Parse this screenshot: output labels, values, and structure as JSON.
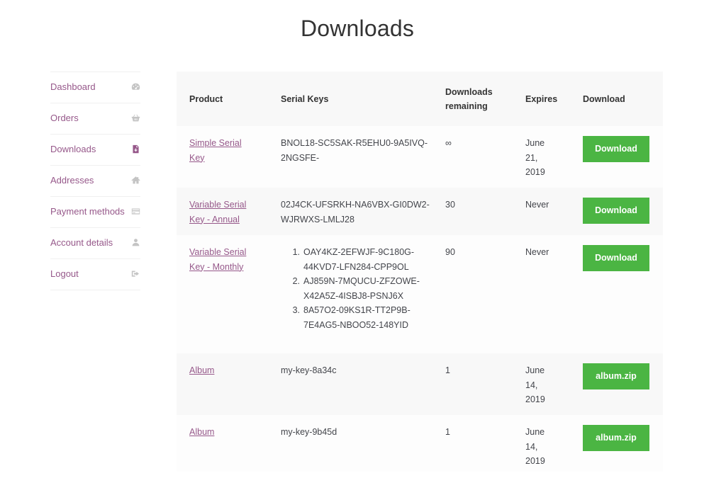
{
  "page": {
    "title": "Downloads"
  },
  "nav": {
    "items": [
      {
        "label": "Dashboard",
        "icon": "dashboard-icon"
      },
      {
        "label": "Orders",
        "icon": "basket-icon"
      },
      {
        "label": "Downloads",
        "icon": "file-download-icon",
        "active": true
      },
      {
        "label": "Addresses",
        "icon": "home-icon"
      },
      {
        "label": "Payment methods",
        "icon": "credit-card-icon"
      },
      {
        "label": "Account details",
        "icon": "user-icon"
      },
      {
        "label": "Logout",
        "icon": "logout-icon"
      }
    ]
  },
  "table": {
    "headers": {
      "product": "Product",
      "keys": "Serial Keys",
      "remaining_line1": "Downloads",
      "remaining_line2": "remaining",
      "expires": "Expires",
      "download": "Download"
    },
    "rows": [
      {
        "product_line1": "Simple Serial",
        "product_line2": "Key",
        "key_line1": "BNOL18-SC5SAK-R5EHU0-9A5IVQ-",
        "key_line2": "2NGSFE-",
        "remaining": "∞",
        "expires_line1": "June",
        "expires_line2": "21,",
        "expires_line3": "2019",
        "button": "Download"
      },
      {
        "product_line1": "Variable Serial",
        "product_line2": "Key - Annual",
        "key_line1": "02J4CK-UFSRKH-NA6VBX-GI0DW2-",
        "key_line2": "WJRWXS-LMLJ28",
        "remaining": "30",
        "expires_line1": "Never",
        "button": "Download"
      },
      {
        "product_line1": "Variable Serial",
        "product_line2": "Key - Monthly",
        "keys": [
          {
            "num": "1.",
            "line1": "OAY4KZ-2EFWJF-9C180G-",
            "line2": "44KVD7-LFN284-CPP9OL"
          },
          {
            "num": "2.",
            "line1": "AJ859N-7MQUCU-ZFZOWE-",
            "line2": "X42A5Z-4ISBJ8-PSNJ6X"
          },
          {
            "num": "3.",
            "line1": "8A57O2-09KS1R-TT2P9B-",
            "line2": "7E4AG5-NBOO52-148YID"
          }
        ],
        "remaining": "90",
        "expires_line1": "Never",
        "button": "Download"
      },
      {
        "product_line1": "Album",
        "key_line1": "my-key-8a34c",
        "remaining": "1",
        "expires_line1": "June",
        "expires_line2": "14,",
        "expires_line3": "2019",
        "button": "album.zip"
      },
      {
        "product_line1": "Album",
        "key_line1": "my-key-9b45d",
        "remaining": "1",
        "expires_line1": "June",
        "expires_line2": "14,",
        "expires_line3": "2019",
        "button": "album.zip"
      }
    ]
  },
  "colors": {
    "accent": "#96588a",
    "button": "#4bb543",
    "icon": "#c0c0c0"
  }
}
